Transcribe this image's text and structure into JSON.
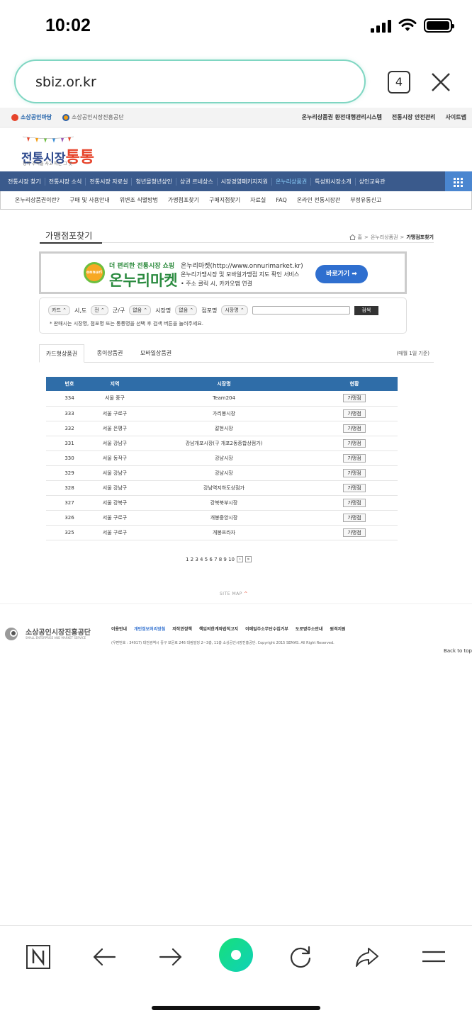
{
  "status": {
    "time": "10:02"
  },
  "browser": {
    "url": "sbiz.or.kr",
    "tab_count": "4"
  },
  "topstrip": {
    "left1": "소상공인마당",
    "left2": "소상공인시장진흥공단",
    "links": [
      "온누리상품권 환전대행관리시스템",
      "전통시장 안전관리",
      "사이트맵"
    ]
  },
  "logo": {
    "title_a": "전통시장",
    "title_b": "통통",
    "sub": "정과 추억을 사고 파는 그 곳"
  },
  "mainnav": [
    "전통시장 찾기",
    "전통시장 소식",
    "전통시장 자료실",
    "청년몰청년상인",
    "상권 르네상스",
    "시장경영패키지지원",
    "온누리상품권",
    "특성화시장소개",
    "상인교육관"
  ],
  "mainnav_active": 6,
  "subnav": [
    "온누리상품권이란?",
    "구매 및 사용안내",
    "위변조 식별방법",
    "가맹점포찾기",
    "구매지점찾기",
    "자료실",
    "FAQ",
    "온라인 전통시장관",
    "부정유통신고"
  ],
  "page": {
    "title": "가맹점포찾기",
    "crumb_home": "홈",
    "crumb_mid": "온누리상품권",
    "crumb_cur": "가맹점포찾기"
  },
  "banner": {
    "logo_text": "onnuri",
    "small": "더 편리한 전통시장 쇼핑",
    "big": "온누리마켓",
    "line1": "온누리마켓(http://www.onnurimarket.kr)",
    "line2": "온누리가맹시장 및 모바일가맹점 지도 확인 서비스",
    "line3": "• 주소 클릭 시, 카카오맵 연결",
    "button": "바로가기 ➡"
  },
  "search": {
    "sel1": "카드 ⌃",
    "label_sido": "시,도",
    "sel_sido": "전 ⌃",
    "label_gungu": "군/구",
    "sel_gungu": "없음 ⌃",
    "label_market": "시장명",
    "sel_market": "없음 ⌃",
    "label_store": "점포명",
    "sel_store": "시장명 ⌃",
    "button": "검색",
    "note": "* 판매시는 시장명, 점포명 또는 통통명을 선택 후 검색 버튼을 눌러주세요."
  },
  "tabs": [
    "카드형상품권",
    "종이상품권",
    "모바일상품권"
  ],
  "tabs_as_of": "(매월 1일 기준)",
  "table": {
    "headers": [
      "번호",
      "지역",
      "시장명",
      "현황"
    ],
    "rows": [
      {
        "no": "334",
        "region": "서울 중구",
        "market": "Team204",
        "status": "가맹점"
      },
      {
        "no": "333",
        "region": "서울 구로구",
        "market": "가리봉시장",
        "status": "가맹점"
      },
      {
        "no": "332",
        "region": "서울 은평구",
        "market": "갈현시장",
        "status": "가맹점"
      },
      {
        "no": "331",
        "region": "서울 강남구",
        "market": "강남개포시장(구 개포2동종합상점가)",
        "status": "가맹점"
      },
      {
        "no": "330",
        "region": "서울 동작구",
        "market": "강남시장",
        "status": "가맹점"
      },
      {
        "no": "329",
        "region": "서울 강남구",
        "market": "강남시장",
        "status": "가맹점"
      },
      {
        "no": "328",
        "region": "서울 강남구",
        "market": "강남역지하도상점가",
        "status": "가맹점"
      },
      {
        "no": "327",
        "region": "서울 강북구",
        "market": "강북북부시장",
        "status": "가맹점"
      },
      {
        "no": "326",
        "region": "서울 구로구",
        "market": "개봉중앙시장",
        "status": "가맹점"
      },
      {
        "no": "325",
        "region": "서울 구로구",
        "market": "개봉프라자",
        "status": "가맹점"
      }
    ]
  },
  "pagination": {
    "pages": "1 2 3 4 5 6 7 8 9 10",
    "next": "›",
    "last": "»"
  },
  "sitemap": {
    "label": "SITE MAP",
    "arrow": "^"
  },
  "footer": {
    "name": "소상공인시장진흥공단",
    "name_en": "SMALL ENTERPRISE AND MARKET SERVICE",
    "links": [
      "이용안내",
      "개인정보처리방침",
      "저작권정책",
      "책임의한계와법적고지",
      "이메일주소무단수집거부",
      "도로명주소안내",
      "원격지원"
    ],
    "address": "(우편번호 : 34917) 대전광역시 중구 보문로 246 대림빌딩 2~3층, 11층 소상공인시장진흥공단. Copyright 2015 SEMAS. All Right Reserved.",
    "back_to_top": "Back to top"
  },
  "toolbar_icons": [
    "naver-n-icon",
    "back-arrow-icon",
    "forward-arrow-icon",
    "green-home-icon",
    "reload-icon",
    "share-icon",
    "menu-icon"
  ]
}
